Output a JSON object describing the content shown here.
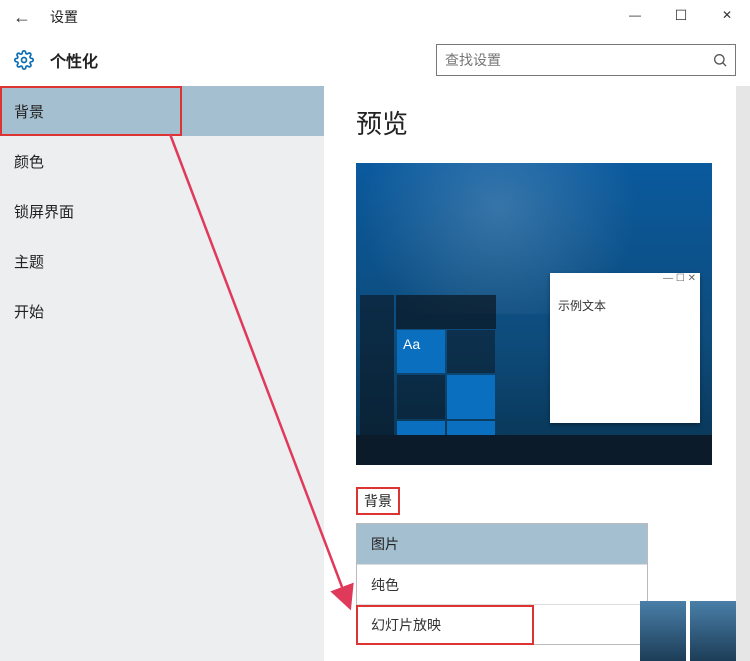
{
  "titlebar": {
    "app_title": "设置"
  },
  "header": {
    "page_title": "个性化",
    "search_placeholder": "查找设置"
  },
  "sidebar": {
    "items": [
      {
        "label": "背景",
        "selected": true
      },
      {
        "label": "颜色",
        "selected": false
      },
      {
        "label": "锁屏界面",
        "selected": false
      },
      {
        "label": "主题",
        "selected": false
      },
      {
        "label": "开始",
        "selected": false
      }
    ]
  },
  "content": {
    "preview_heading": "预览",
    "sample_text": "示例文本",
    "tile_aa": "Aa",
    "bg_section_label": "背景",
    "dropdown": {
      "options": [
        {
          "label": "图片",
          "selected": true
        },
        {
          "label": "纯色",
          "selected": false
        },
        {
          "label": "幻灯片放映",
          "selected": false
        }
      ]
    }
  },
  "icons": {
    "back": "←",
    "minimize": "—",
    "maximize": "☐",
    "close": "✕",
    "search": "🔍"
  }
}
